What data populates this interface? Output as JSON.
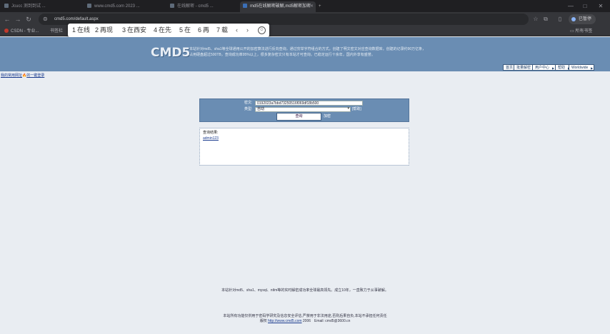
{
  "browser": {
    "tabs": [
      {
        "title": "Jcucc 测到到试 ..."
      },
      {
        "title": "www.cmd5.com 2023 ..."
      },
      {
        "title": "在线解密 - cmd5 ..."
      },
      {
        "title": "md5在线解密破解,md5解密加密"
      }
    ],
    "address": "cmd5.com/default.aspx",
    "profile_label": "已暂停",
    "bookmarks": [
      "CSDN - 专业...",
      "书签栏"
    ],
    "bookmarks_right": "所有书签"
  },
  "ime": {
    "candidates": [
      {
        "n": "1",
        "text": "在线"
      },
      {
        "n": "2",
        "text": "再现"
      },
      {
        "n": "3",
        "text": "在西安"
      },
      {
        "n": "4",
        "text": "在先"
      },
      {
        "n": "5",
        "text": "在"
      },
      {
        "n": "6",
        "text": "再"
      },
      {
        "n": "7",
        "text": "载"
      }
    ],
    "prev": "‹",
    "next": "›",
    "emoji": "☺"
  },
  "site": {
    "logo": "CMD5",
    "intro_line1": "本站针对md5、sha1等全球通用公开的加密算法进行反向查询，通过穷举字符组合的方式，创建了明文密文对应查询数据库，创建的记录约90万亿条，",
    "intro_line2": "占用硬盘超过500TB，查询成功率95%以上，很多复杂密文只有本站才可查询。已稳定运行十余年，国内外享有盛誉。",
    "nav": [
      "首页",
      "批量解密",
      "用户中心",
      "帮助",
      "Worldwide"
    ],
    "page_links": [
      "我的常用网址",
      "的一键登录"
    ]
  },
  "form": {
    "cipher_label": "密文:",
    "cipher_value": "0192023a7bbd73250516f069df18b500",
    "type_label": "类型:",
    "type_value": "自动",
    "help_link": "[帮助]",
    "submit_label": "查询",
    "advanced_label": "加密"
  },
  "result": {
    "title": "查询结果:",
    "value": "admin123"
  },
  "footer": {
    "line1": "本站针对md5、sha1、mysql、ntlm等的实时解密成功率全球最高领先。成立10年，一直致力于从事破解。",
    "line2": "本站所有功能仅供用于密码学研究及信息安全评估,严禁用于非法用途,否则后果自负,本站不承担任何责任",
    "line3_prefix": "版权",
    "line3_link": "http://www.cmd5.com",
    "line3_suffix": "2006　Email: cmd5@3600.cn"
  }
}
